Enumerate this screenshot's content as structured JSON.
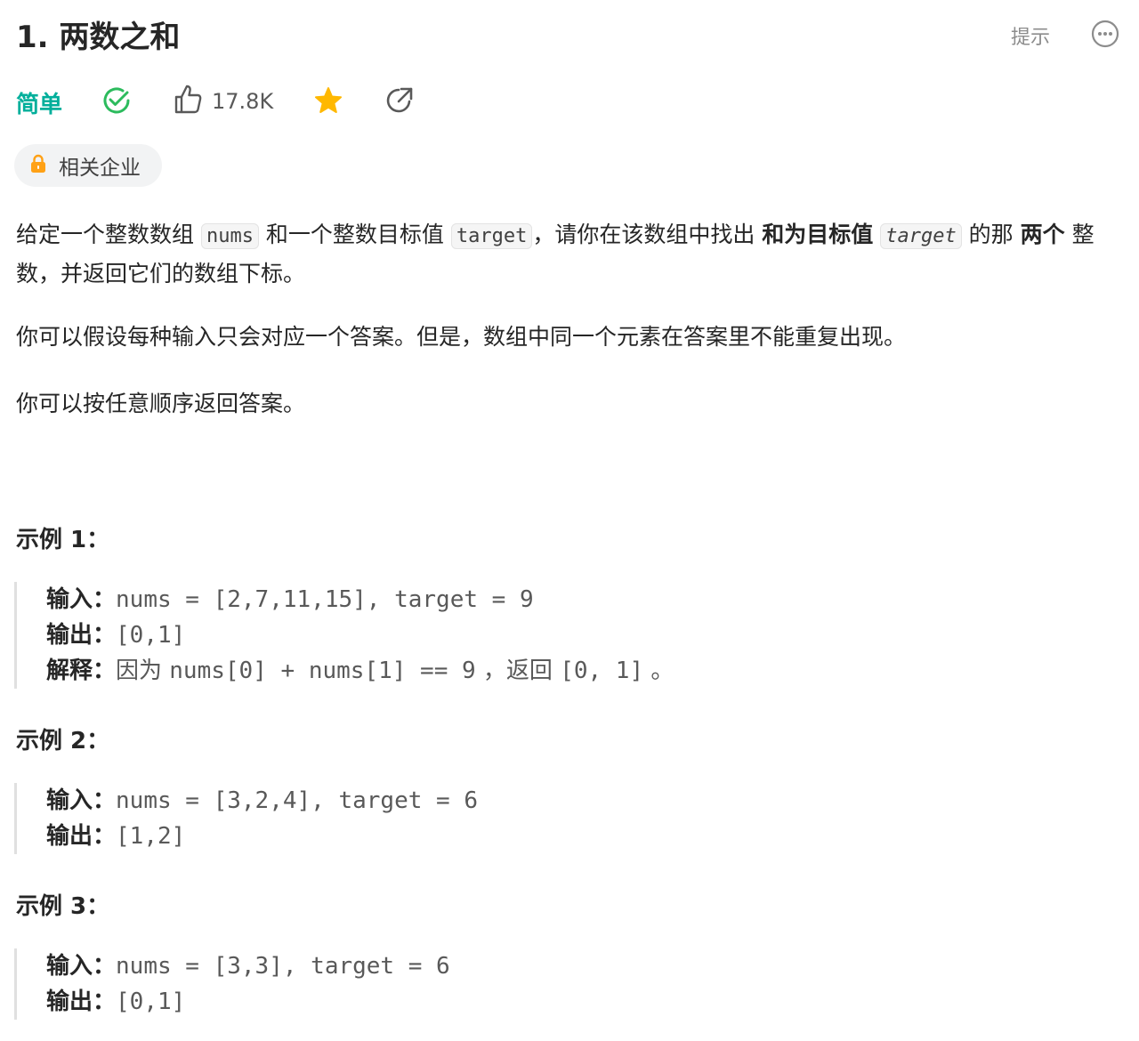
{
  "header": {
    "title": "1. 两数之和",
    "hint_label": "提示"
  },
  "meta": {
    "difficulty": "简单",
    "likes": "17.8K",
    "colors": {
      "easy": "#00af9b",
      "solved": "#2cbb5d",
      "star": "#ffb800",
      "lock": "#ffa116"
    }
  },
  "company_tag": {
    "label": "相关企业"
  },
  "description": {
    "p1_a": "给定一个整数数组 ",
    "p1_code1": "nums",
    "p1_b": " 和一个整数目标值 ",
    "p1_code2": "target",
    "p1_c": "，请你在该数组中找出 ",
    "p1_bold1": "和为目标值",
    "p1_code3": "target",
    "p1_d": "  的那 ",
    "p1_bold2": "两个",
    "p1_e": " 整数，并返回它们的数组下标。",
    "p2": "你可以假设每种输入只会对应一个答案。但是，数组中同一个元素在答案里不能重复出现。",
    "p3": "你可以按任意顺序返回答案。"
  },
  "examples": [
    {
      "title": "示例 1：",
      "input_key": "输入：",
      "input": "nums = [2,7,11,15], target = 9",
      "output_key": "输出：",
      "output": "[0,1]",
      "explain_key": "解释：",
      "explain_a": "因为 ",
      "explain_b": "nums[0] + nums[1] == 9",
      "explain_c": " ，返回 ",
      "explain_d": "[0, 1]",
      "explain_e": " 。"
    },
    {
      "title": "示例 2：",
      "input_key": "输入：",
      "input": "nums = [3,2,4], target = 6",
      "output_key": "输出：",
      "output": "[1,2]"
    },
    {
      "title": "示例 3：",
      "input_key": "输入：",
      "input": "nums = [3,3], target = 6",
      "output_key": "输出：",
      "output": "[0,1]"
    }
  ],
  "icons": {
    "more": "more-horizontal-icon",
    "solved": "check-circle-icon",
    "like": "thumbs-up-icon",
    "star": "star-icon",
    "share": "share-icon",
    "lock": "lock-icon"
  }
}
